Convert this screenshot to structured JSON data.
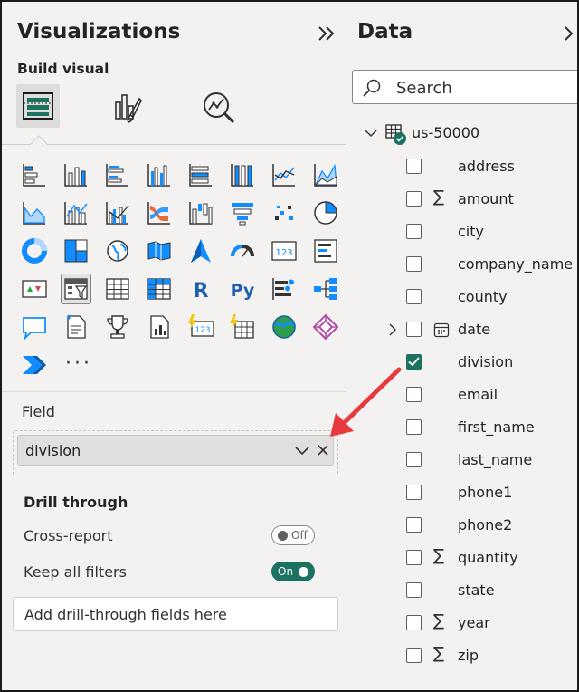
{
  "visualizations": {
    "title": "Visualizations",
    "build_visual": "Build visual",
    "tabs": [
      "build-visual-icon",
      "format-visual-icon",
      "analytics-icon"
    ],
    "more_label": "···",
    "field_section": {
      "label": "Field",
      "value": "division"
    },
    "drill_through": {
      "title": "Drill through",
      "cross_report_label": "Cross-report",
      "cross_report_state": "Off",
      "keep_filters_label": "Keep all filters",
      "keep_filters_state": "On",
      "drop_placeholder": "Add drill-through fields here"
    }
  },
  "data": {
    "title": "Data",
    "search_placeholder": "Search",
    "table": "us-50000",
    "fields": [
      {
        "name": "address",
        "checked": false,
        "icon": ""
      },
      {
        "name": "amount",
        "checked": false,
        "icon": "sigma"
      },
      {
        "name": "city",
        "checked": false,
        "icon": ""
      },
      {
        "name": "company_name",
        "checked": false,
        "icon": ""
      },
      {
        "name": "county",
        "checked": false,
        "icon": ""
      },
      {
        "name": "date",
        "checked": false,
        "icon": "calendar"
      },
      {
        "name": "division",
        "checked": true,
        "icon": ""
      },
      {
        "name": "email",
        "checked": false,
        "icon": ""
      },
      {
        "name": "first_name",
        "checked": false,
        "icon": ""
      },
      {
        "name": "last_name",
        "checked": false,
        "icon": ""
      },
      {
        "name": "phone1",
        "checked": false,
        "icon": ""
      },
      {
        "name": "phone2",
        "checked": false,
        "icon": ""
      },
      {
        "name": "quantity",
        "checked": false,
        "icon": "sigma"
      },
      {
        "name": "state",
        "checked": false,
        "icon": ""
      },
      {
        "name": "year",
        "checked": false,
        "icon": "sigma"
      },
      {
        "name": "zip",
        "checked": false,
        "icon": "sigma"
      }
    ],
    "sigma_symbol": "∑"
  },
  "colors": {
    "accent": "#1b7261",
    "annotation_arrow": "#e8393d"
  }
}
